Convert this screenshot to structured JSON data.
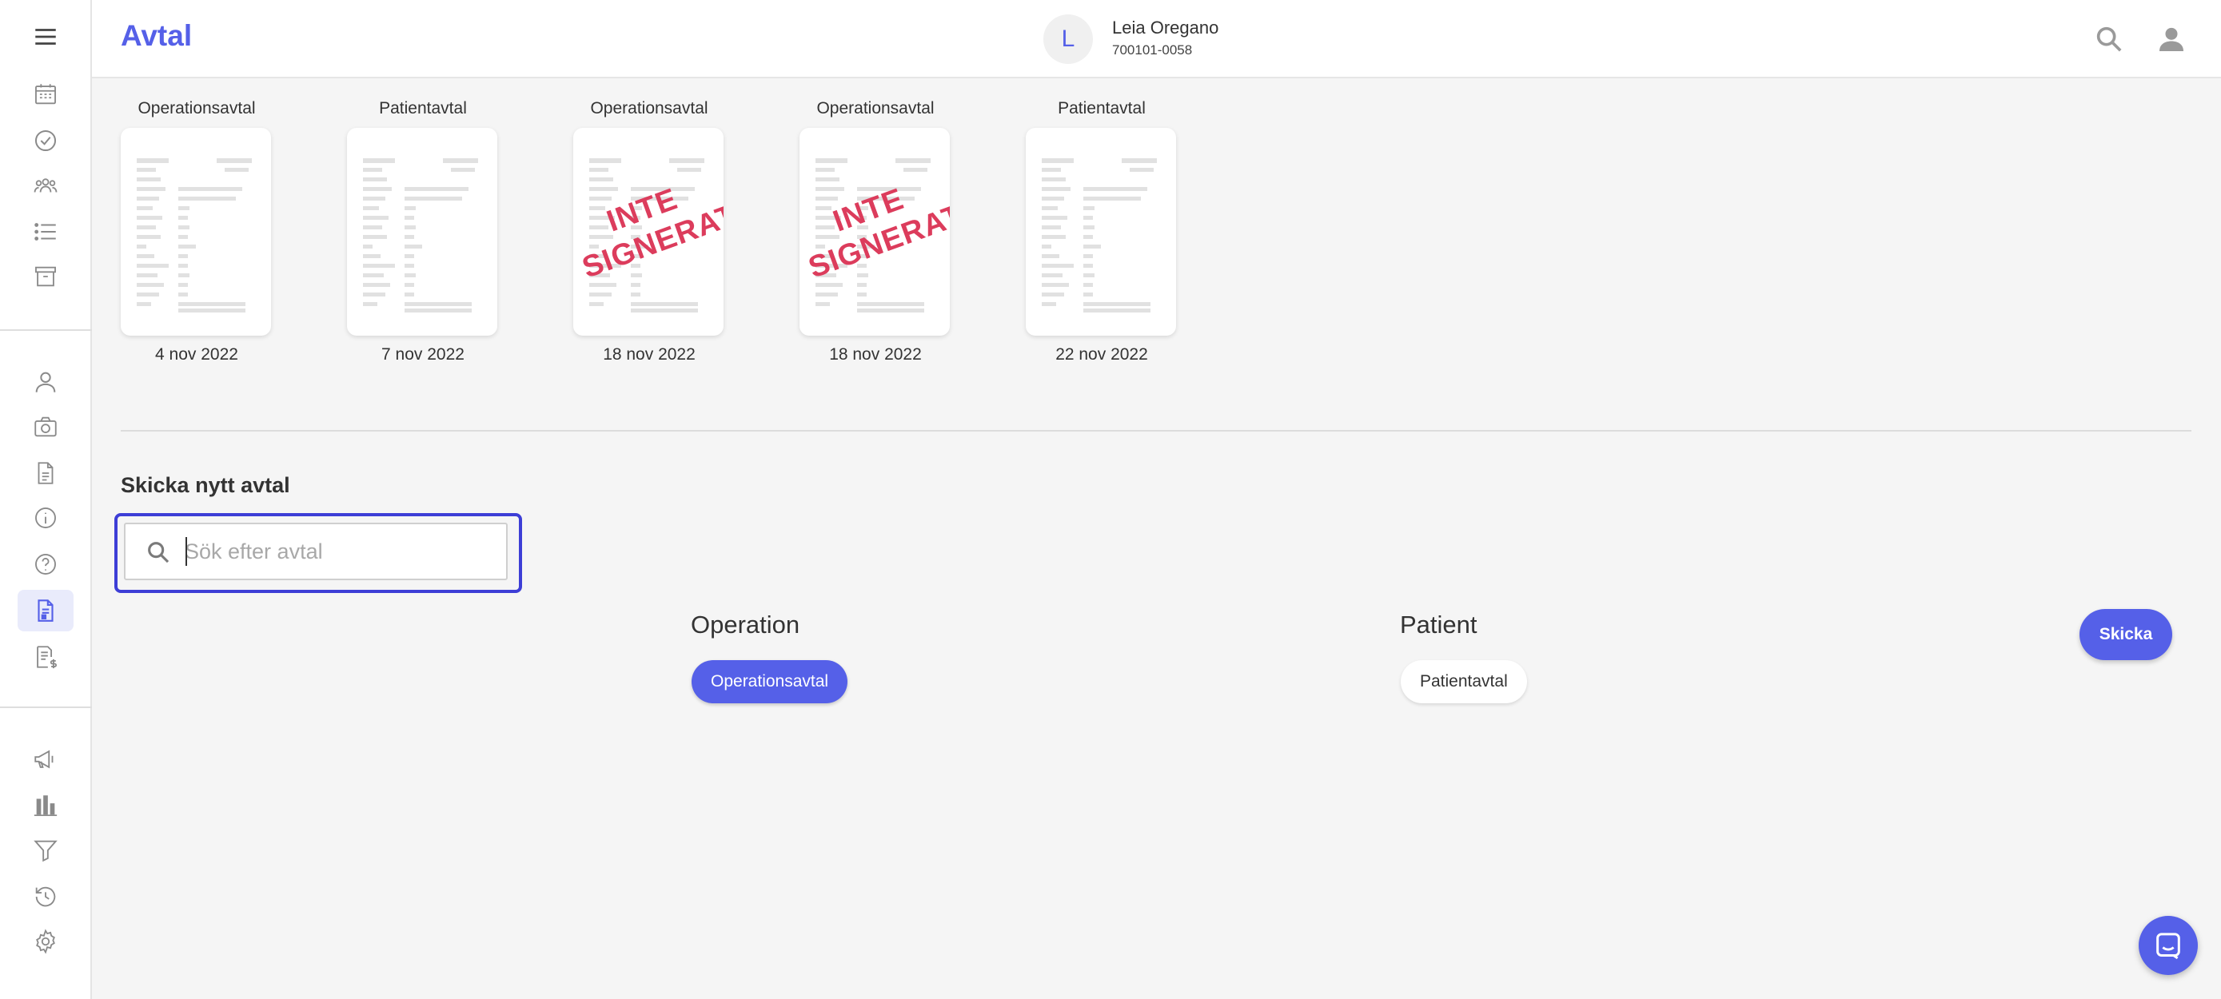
{
  "app": {
    "title": "Avtal"
  },
  "colors": {
    "accent": "#5560e8",
    "stamp": "#dc3c5c"
  },
  "patient": {
    "initial": "L",
    "name": "Leia Oregano",
    "id": "700101-0058"
  },
  "sidebar": {
    "items": [
      {
        "icon": "menu-icon"
      },
      {
        "icon": "calendar-icon"
      },
      {
        "icon": "check-circle-icon"
      },
      {
        "icon": "group-icon"
      },
      {
        "icon": "list-icon"
      },
      {
        "icon": "archive-icon"
      },
      {
        "icon": "person-icon"
      },
      {
        "icon": "camera-icon"
      },
      {
        "icon": "document-icon"
      },
      {
        "icon": "info-icon"
      },
      {
        "icon": "help-icon"
      },
      {
        "icon": "contract-icon",
        "active": true
      },
      {
        "icon": "invoice-icon"
      },
      {
        "icon": "megaphone-icon"
      },
      {
        "icon": "bar-chart-icon"
      },
      {
        "icon": "filter-icon"
      },
      {
        "icon": "history-icon"
      },
      {
        "icon": "settings-icon"
      }
    ]
  },
  "documents": [
    {
      "type": "Operationsavtal",
      "date": "4 nov 2022",
      "signed": true
    },
    {
      "type": "Patientavtal",
      "date": "7 nov 2022",
      "signed": true
    },
    {
      "type": "Operationsavtal",
      "date": "18 nov 2022",
      "signed": false,
      "stamp": "INTE SIGNERAT"
    },
    {
      "type": "Operationsavtal",
      "date": "18 nov 2022",
      "signed": false,
      "stamp": "INTE SIGNERAT"
    },
    {
      "type": "Patientavtal",
      "date": "22 nov 2022",
      "signed": true
    }
  ],
  "new_contract": {
    "title": "Skicka nytt avtal",
    "search": {
      "placeholder": "Sök efter avtal",
      "value": ""
    },
    "groups": [
      {
        "title": "Operation",
        "items": [
          "Operationsavtal"
        ],
        "selected": "Operationsavtal"
      },
      {
        "title": "Patient",
        "items": [
          "Patientavtal"
        ]
      }
    ],
    "send_label": "Skicka"
  }
}
